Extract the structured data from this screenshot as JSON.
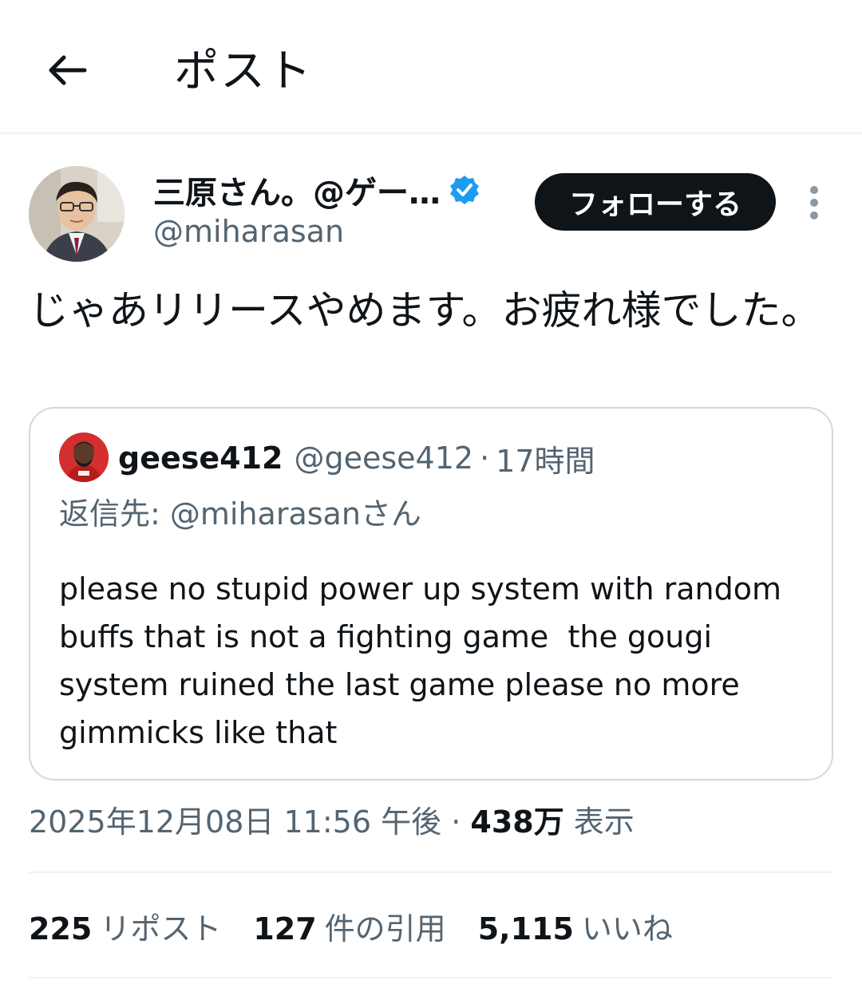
{
  "header": {
    "title": "ポスト",
    "back_icon": "arrow-left-icon"
  },
  "author": {
    "display_name": "三原さん。@ゲー…",
    "handle": "@miharasan",
    "verified_icon": "verified-badge-icon",
    "verified_color": "#1d9bf0"
  },
  "follow_button": {
    "label": "フォローする"
  },
  "more_icon": "more-vertical-icon",
  "post": {
    "text": "じゃあリリースやめます。お疲れ様でした。"
  },
  "quote": {
    "name": "geese412",
    "handle": "@geese412",
    "separator": "·",
    "time": "17時間",
    "reply_to": "返信先: @miharasanさん",
    "text": "please no stupid power up system with random buffs that is not a fighting game  the gougi system ruined the last game please no more gimmicks like that"
  },
  "meta": {
    "datetime": "2025年12月08日 11:56 午後",
    "separator": "·",
    "views_count": "438万",
    "views_label": "表示"
  },
  "stats": {
    "reposts": {
      "count": "225",
      "label": "リポスト"
    },
    "quotes": {
      "count": "127",
      "label": "件の引用"
    },
    "likes": {
      "count": "5,115",
      "label": "いいね"
    }
  },
  "colors": {
    "text_primary": "#0f1419",
    "text_secondary": "#536471",
    "border": "#cfd9de",
    "accent": "#1d9bf0"
  }
}
